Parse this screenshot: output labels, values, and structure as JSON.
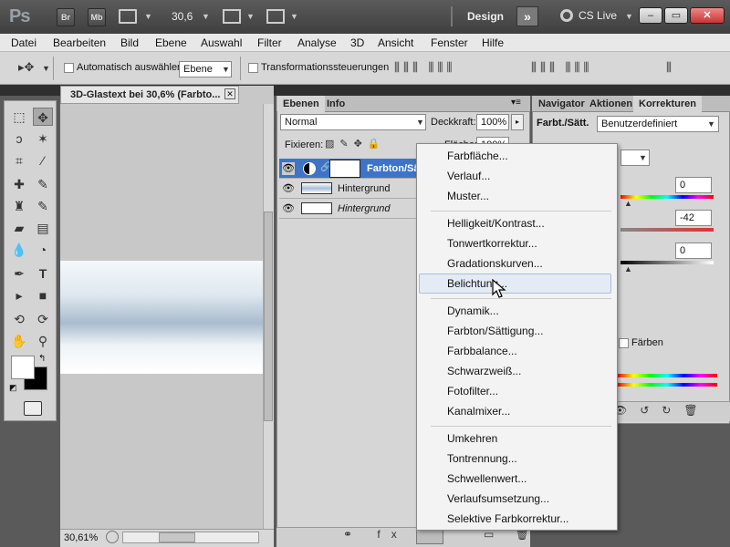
{
  "appbar": {
    "logo": "Ps",
    "btn_br": "Br",
    "btn_mb": "Mb",
    "zoom": "30,6",
    "workspace": "Design",
    "cslive": "CS Live"
  },
  "menu": [
    "Datei",
    "Bearbeiten",
    "Bild",
    "Ebene",
    "Auswahl",
    "Filter",
    "Analyse",
    "3D",
    "Ansicht",
    "Fenster",
    "Hilfe"
  ],
  "options": {
    "auto_select_label": "Automatisch auswählen:",
    "auto_select_value": "Ebene",
    "transform_label": "Transformationssteuerungen"
  },
  "document": {
    "tab_title": "3D-Glastext bei 30,6% (Farbto...",
    "zoom_status": "30,61%"
  },
  "layers_panel": {
    "tab_ebenen": "Ebenen",
    "tab_info": "Info",
    "blend_mode": "Normal",
    "opacity_label": "Deckkraft:",
    "opacity_value": "100%",
    "lock_label": "Fixieren:",
    "fill_label": "Fläche:",
    "fill_value": "100%",
    "layers": [
      {
        "name": "Farbton/Sä"
      },
      {
        "name": "Hintergrund"
      },
      {
        "name": "Hintergrund"
      }
    ]
  },
  "right_panel": {
    "tab_navigator": "Navigator",
    "tab_aktionen": "Aktionen",
    "tab_korrekturen": "Korrekturen",
    "title": "Farbt./Sätt.",
    "preset": "Benutzerdefiniert",
    "hue": "0",
    "saturation": "-42",
    "lightness": "0",
    "colorize_label": "Färben"
  },
  "dropdown": {
    "items": [
      "Farbfläche...",
      "Verlauf...",
      "Muster...",
      "Helligkeit/Kontrast...",
      "Tonwertkorrektur...",
      "Gradationskurven...",
      "Belichtung...",
      "Dynamik...",
      "Farbton/Sättigung...",
      "Farbbalance...",
      "Schwarzweiß...",
      "Fotofilter...",
      "Kanalmixer...",
      "Umkehren",
      "Tontrennung...",
      "Schwellenwert...",
      "Verlaufsumsetzung...",
      "Selektive Farbkorrektur..."
    ],
    "hovered": "Belichtung..."
  }
}
